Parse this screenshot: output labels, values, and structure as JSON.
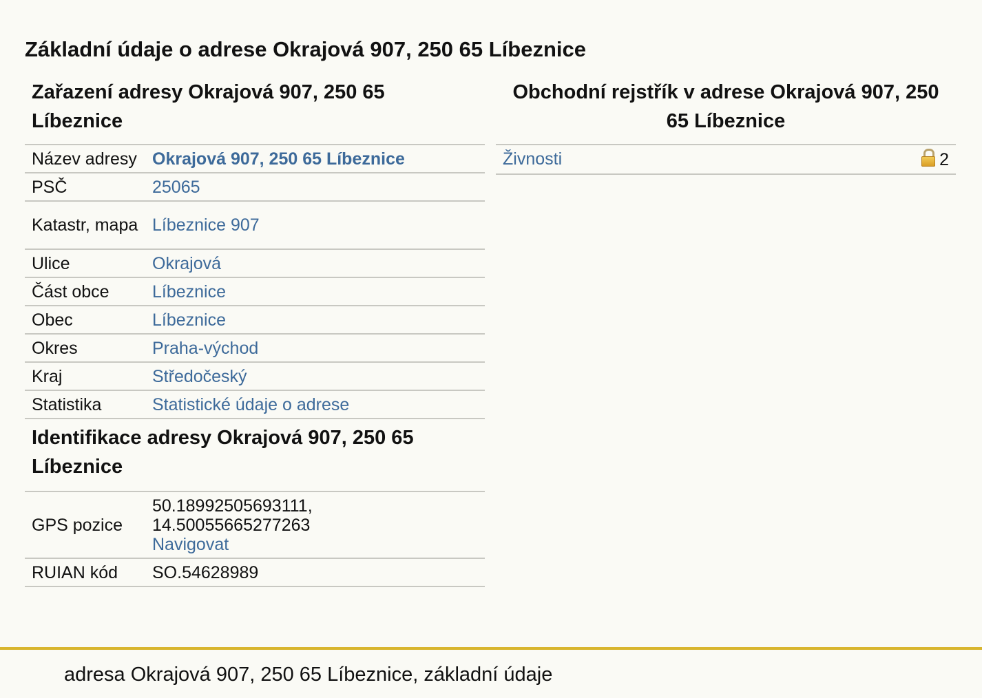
{
  "page": {
    "title": "Základní údaje o adrese Okrajová 907, 250 65 Líbeznice"
  },
  "zarazeni": {
    "title": "Zařazení adresy Okrajová 907, 250 65 Líbeznice",
    "rows": [
      {
        "label": "Název adresy",
        "value": "Okrajová 907, 250 65 Líbeznice"
      },
      {
        "label": "PSČ",
        "value": "25065"
      },
      {
        "label": "Katastr, mapa",
        "value": "Líbeznice 907"
      },
      {
        "label": "Ulice",
        "value": "Okrajová"
      },
      {
        "label": "Část obce",
        "value": "Líbeznice"
      },
      {
        "label": "Obec",
        "value": "Líbeznice"
      },
      {
        "label": "Okres",
        "value": "Praha-východ"
      },
      {
        "label": "Kraj",
        "value": "Středočeský"
      },
      {
        "label": "Statistika",
        "value": "Statistické údaje o adrese"
      }
    ]
  },
  "identifikace": {
    "title": "Identifikace adresy Okrajová 907, 250 65 Líbeznice",
    "gps_label": "GPS pozice",
    "gps_lat": "50.18992505693111,",
    "gps_lon": "14.50055665277263",
    "gps_link": "Navigovat",
    "ruian_label": "RUIAN kód",
    "ruian_value": "SO.54628989"
  },
  "rejstrik": {
    "title": "Obchodní rejstřík v adrese Okrajová 907, 250 65 Líbeznice",
    "items": [
      {
        "label": "Živnosti",
        "count": "2",
        "icon": "lock-icon"
      }
    ]
  },
  "footer": {
    "text": "adresa Okrajová 907, 250 65 Líbeznice, základní údaje"
  },
  "colors": {
    "link": "#3d6a9a",
    "footer_border": "#d8b52e",
    "background": "#fafaf5"
  }
}
